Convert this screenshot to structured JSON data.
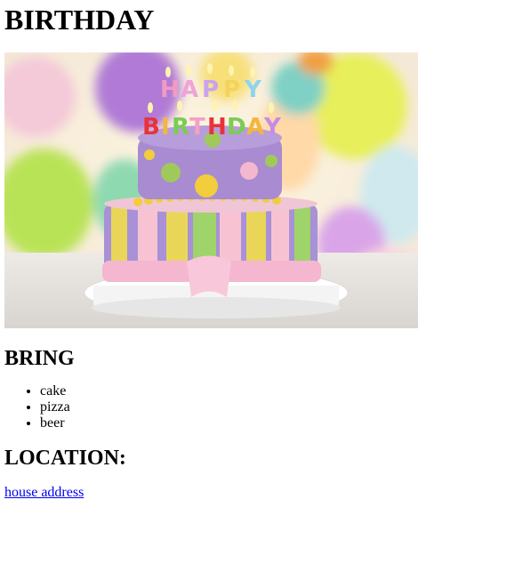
{
  "page": {
    "title": "BIRTHDAY",
    "image": {
      "alt": "Birthday cake",
      "candle_letters": "HAPPY BIRTHDAY"
    },
    "bring_heading": "BRING",
    "bring_items": [
      "cake",
      "pizza",
      "beer"
    ],
    "location_heading": "LOCATION:",
    "location_link": "house address"
  },
  "colors": {
    "link": "#0000ee",
    "text": "#000000",
    "background": "#ffffff"
  }
}
